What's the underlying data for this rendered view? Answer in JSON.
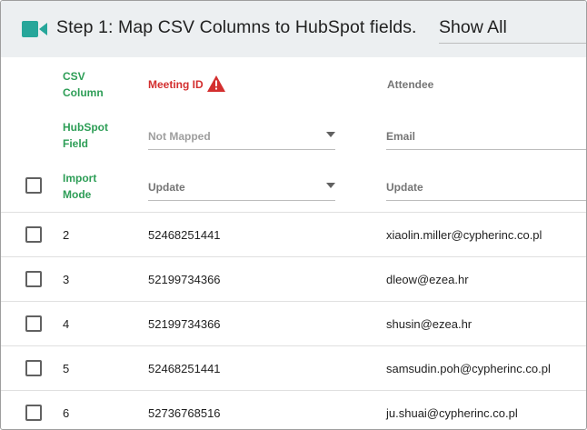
{
  "header": {
    "title": "Step 1: Map CSV Columns to HubSpot fields.",
    "filter_value": "Show All",
    "icon": "video-camera-icon",
    "icon_color": "#26a69a"
  },
  "labels": {
    "csv_column": [
      "CSV",
      "Column"
    ],
    "hubspot_field": [
      "HubSpot",
      "Field"
    ],
    "import_mode": [
      "Import",
      "Mode"
    ]
  },
  "columns": [
    {
      "csv_column": "Meeting ID",
      "has_warning": true,
      "hubspot_field": "Not Mapped",
      "import_mode": "Update"
    },
    {
      "csv_column": "Attendee",
      "has_warning": false,
      "hubspot_field": "Email",
      "import_mode": "Update"
    }
  ],
  "rows": [
    {
      "row": "2",
      "meeting_id": "52468251441",
      "attendee": "xiaolin.miller@cypherinc.co.pl"
    },
    {
      "row": "3",
      "meeting_id": "52199734366",
      "attendee": "dleow@ezea.hr"
    },
    {
      "row": "4",
      "meeting_id": "52199734366",
      "attendee": "shusin@ezea.hr"
    },
    {
      "row": "5",
      "meeting_id": "52468251441",
      "attendee": "samsudin.poh@cypherinc.co.pl"
    },
    {
      "row": "6",
      "meeting_id": "52736768516",
      "attendee": "ju.shuai@cypherinc.co.pl"
    }
  ],
  "colors": {
    "label_green": "#2e9e57",
    "warning_red": "#d32f2f",
    "header_bg": "#eceff1"
  }
}
